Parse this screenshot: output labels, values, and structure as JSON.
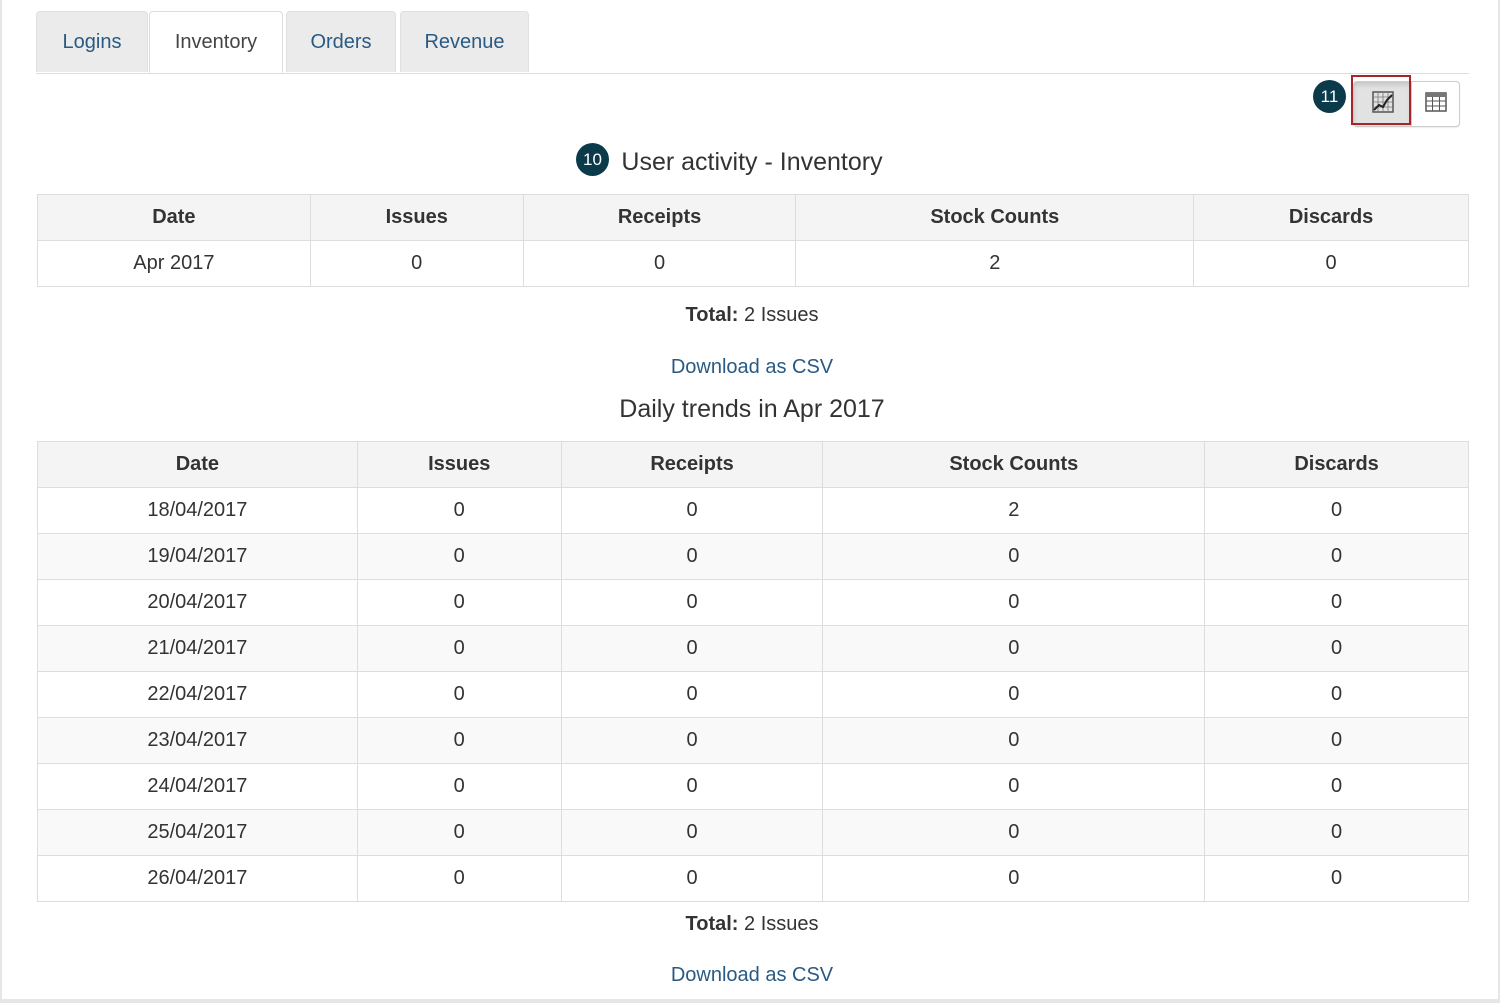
{
  "tabs": [
    {
      "label": "Logins",
      "active": false
    },
    {
      "label": "Inventory",
      "active": true
    },
    {
      "label": "Orders",
      "active": false
    },
    {
      "label": "Revenue",
      "active": false
    }
  ],
  "callouts": {
    "view_toggle_badge": "11",
    "title_badge": "10"
  },
  "view_toggle": {
    "selected": "chart",
    "chart_icon": "chart-icon",
    "table_icon": "table-icon"
  },
  "summary": {
    "title": "User activity - Inventory",
    "columns": [
      "Date",
      "Issues",
      "Receipts",
      "Stock Counts",
      "Discards"
    ],
    "rows": [
      [
        "Apr 2017",
        "0",
        "0",
        "2",
        "0"
      ]
    ],
    "total_label": "Total:",
    "total_value": "2 Issues",
    "download_label": "Download as CSV"
  },
  "daily": {
    "title": "Daily trends in Apr 2017",
    "columns": [
      "Date",
      "Issues",
      "Receipts",
      "Stock Counts",
      "Discards"
    ],
    "rows": [
      [
        "18/04/2017",
        "0",
        "0",
        "2",
        "0"
      ],
      [
        "19/04/2017",
        "0",
        "0",
        "0",
        "0"
      ],
      [
        "20/04/2017",
        "0",
        "0",
        "0",
        "0"
      ],
      [
        "21/04/2017",
        "0",
        "0",
        "0",
        "0"
      ],
      [
        "22/04/2017",
        "0",
        "0",
        "0",
        "0"
      ],
      [
        "23/04/2017",
        "0",
        "0",
        "0",
        "0"
      ],
      [
        "24/04/2017",
        "0",
        "0",
        "0",
        "0"
      ],
      [
        "25/04/2017",
        "0",
        "0",
        "0",
        "0"
      ],
      [
        "26/04/2017",
        "0",
        "0",
        "0",
        "0"
      ]
    ],
    "total_label": "Total:",
    "total_value": "2 Issues",
    "download_label": "Download as CSV"
  },
  "colors": {
    "link": "#2a5a84",
    "badge": "#0b3a4a",
    "highlight": "#a8242b"
  }
}
